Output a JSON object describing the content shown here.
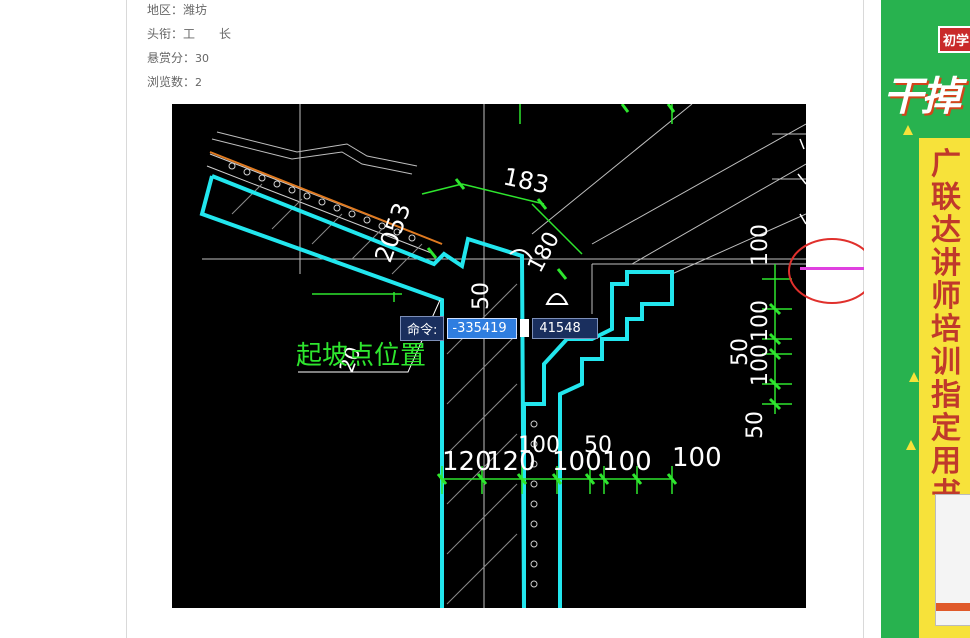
{
  "details": {
    "region_label": "地区：",
    "region_value": "潍坊",
    "title_label": "头衔：",
    "title_value": "工　　长",
    "bounty_label": "悬赏分：",
    "bounty_value": "30",
    "views_label": "浏览数：",
    "views_value": "2"
  },
  "cad_drawing": {
    "annotation_text": "起坡点位置",
    "dims_top": [
      "183",
      "2053",
      "180"
    ],
    "dims_vertical": [
      "50",
      "20"
    ],
    "dims_right_vertical": [
      "100",
      "100",
      "50",
      "100",
      "50"
    ],
    "dims_bottom_upper": [
      "100",
      "50"
    ],
    "dims_bottom_lower": [
      "120",
      "120",
      "100",
      "100",
      "100"
    ],
    "command": {
      "label": "命令:",
      "x_value": "-335419",
      "y_value": "41548"
    }
  },
  "ad": {
    "badge": "初学",
    "slogan": "干掉",
    "vertical_text": "广联达讲师培训指定用书",
    "colors": {
      "background": "#28b24f",
      "accent": "#f7e23a",
      "text": "#c0392b"
    }
  },
  "colors": {
    "cad_background": "#000000",
    "cad_cyan": "#22e6ee",
    "cad_green": "#2ee62e",
    "annotation_red": "#e0302c",
    "magenta": "#e040e0"
  }
}
